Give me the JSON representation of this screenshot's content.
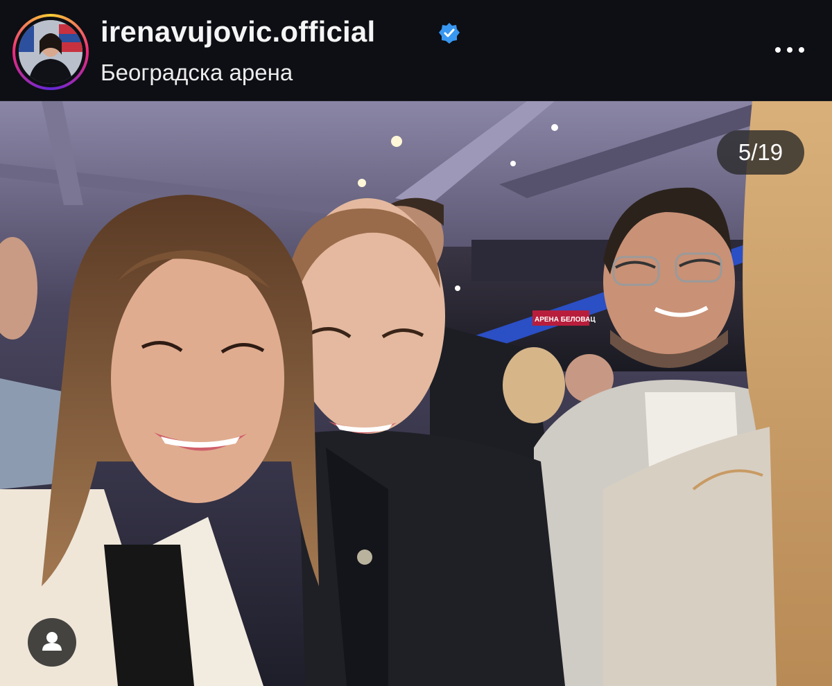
{
  "post": {
    "username": "irenavujovic.official",
    "verified": true,
    "location": "Београдска арена",
    "slide_counter": "5/19",
    "arena_sign": "АРЕНА БЕЛОВАЦ"
  },
  "icons": {
    "verified": "verified-badge-icon",
    "more": "more-options-icon",
    "tag": "tagged-people-icon"
  },
  "colors": {
    "verified_blue": "#3897f0",
    "background": "#0d0f14"
  }
}
